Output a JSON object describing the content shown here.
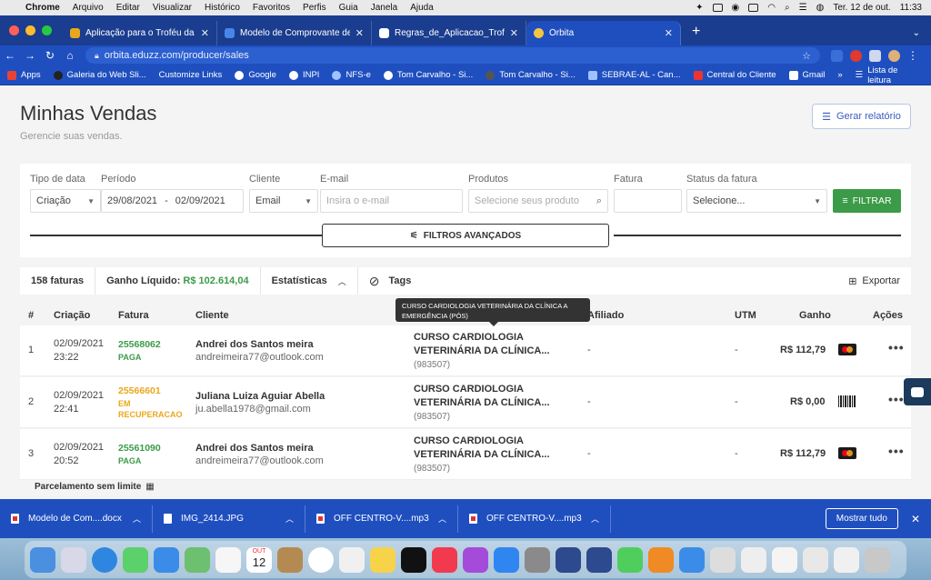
{
  "menubar": {
    "app": "Chrome",
    "items": [
      "Arquivo",
      "Editar",
      "Visualizar",
      "Histórico",
      "Favoritos",
      "Perfis",
      "Guia",
      "Janela",
      "Ajuda"
    ],
    "date": "Ter. 12 de out.",
    "time": "11:33"
  },
  "tabs": [
    {
      "title": "Aplicação para o Troféu da Fór",
      "color": "#e9a81b"
    },
    {
      "title": "Modelo de Comprovante de Fa",
      "color": "#4a86e8"
    },
    {
      "title": "Regras_de_Aplicacao_Trofeu_",
      "color": "#ffffff"
    },
    {
      "title": "Órbita",
      "color": "#f4c542"
    }
  ],
  "toolbar": {
    "url": "orbita.eduzz.com/producer/sales"
  },
  "bookmarks": [
    "Apps",
    "Galeria do Web Sli...",
    "Customize Links",
    "Google",
    "INPI",
    "NFS-e",
    "Tom Carvalho - Si...",
    "Tom Carvalho - Si...",
    "SEBRAE-AL - Can...",
    "Central do Cliente",
    "Gmail"
  ],
  "reading_list": "Lista de leitura",
  "page": {
    "title": "Minhas Vendas",
    "subtitle": "Gerencie suas vendas.",
    "report_button": "Gerar relatório"
  },
  "filters": {
    "labels": {
      "tipo": "Tipo de data",
      "periodo": "Período",
      "cliente": "Cliente",
      "email": "E-mail",
      "produtos": "Produtos",
      "fatura": "Fatura",
      "status": "Status da fatura"
    },
    "tipo_value": "Criação",
    "date_from": "29/08/2021",
    "date_sep": "-",
    "date_to": "02/09/2021",
    "cliente_value": "Email",
    "email_placeholder": "Insira o e-mail",
    "produtos_placeholder": "Selecione seus produto",
    "status_value": "Selecione...",
    "filter_button": "FILTRAR",
    "advanced_button": "FILTROS AVANÇADOS"
  },
  "stats": {
    "count": "158 faturas",
    "net_label": "Ganho Líquido:",
    "net_value": "R$ 102.614,04",
    "stats_label": "Estatísticas",
    "tags_label": "Tags",
    "export_label": "Exportar"
  },
  "table": {
    "headers": {
      "num": "#",
      "created": "Criação",
      "invoice": "Fatura",
      "client": "Cliente",
      "affiliate": "Afiliado",
      "utm": "UTM",
      "gain": "Ganho",
      "actions": "Ações"
    },
    "tooltip": "CURSO CARDIOLOGIA VETERINÁRIA DA CLÍNICA A EMERGÊNCIA (PÓS)",
    "rows": [
      {
        "num": "1",
        "date": "02/09/2021",
        "time": "23:22",
        "invoice": "25568062",
        "status": "PAGA",
        "status_type": "paid",
        "client": "Andrei dos Santos meira",
        "email": "andreimeira77@outlook.com",
        "product_l1": "CURSO CARDIOLOGIA",
        "product_l2": "VETERINÁRIA DA CLÍNICA...",
        "product_id": "(983507)",
        "affiliate": "-",
        "utm": "-",
        "gain": "R$ 112,79",
        "payment": "mastercard"
      },
      {
        "num": "2",
        "date": "02/09/2021",
        "time": "22:41",
        "invoice": "25566601",
        "status": "EM RECUPERACAO",
        "status_type": "recovery",
        "client": "Juliana Luiza Aguiar Abella",
        "email": "ju.abella1978@gmail.com",
        "product_l1": "CURSO CARDIOLOGIA",
        "product_l2": "VETERINÁRIA DA CLÍNICA...",
        "product_id": "(983507)",
        "affiliate": "-",
        "utm": "-",
        "gain": "R$ 0,00",
        "payment": "boleto"
      },
      {
        "num": "3",
        "date": "02/09/2021",
        "time": "20:52",
        "invoice": "25561090",
        "status": "PAGA",
        "status_type": "paid",
        "client": "Andrei dos Santos meira",
        "email": "andreimeira77@outlook.com",
        "product_l1": "CURSO CARDIOLOGIA",
        "product_l2": "VETERINÁRIA DA CLÍNICA...",
        "product_id": "(983507)",
        "affiliate": "-",
        "utm": "-",
        "gain": "R$ 112,79",
        "payment": "mastercard"
      }
    ],
    "installment_note": "Parcelamento sem limite"
  },
  "downloads": {
    "items": [
      "Modelo de Com....docx",
      "IMG_2414.JPG",
      "OFF CENTRO-V....mp3",
      "OFF CENTRO-V....mp3"
    ],
    "show_all": "Mostrar tudo"
  },
  "dock": {
    "calendar_month": "OUT",
    "calendar_day": "12"
  }
}
